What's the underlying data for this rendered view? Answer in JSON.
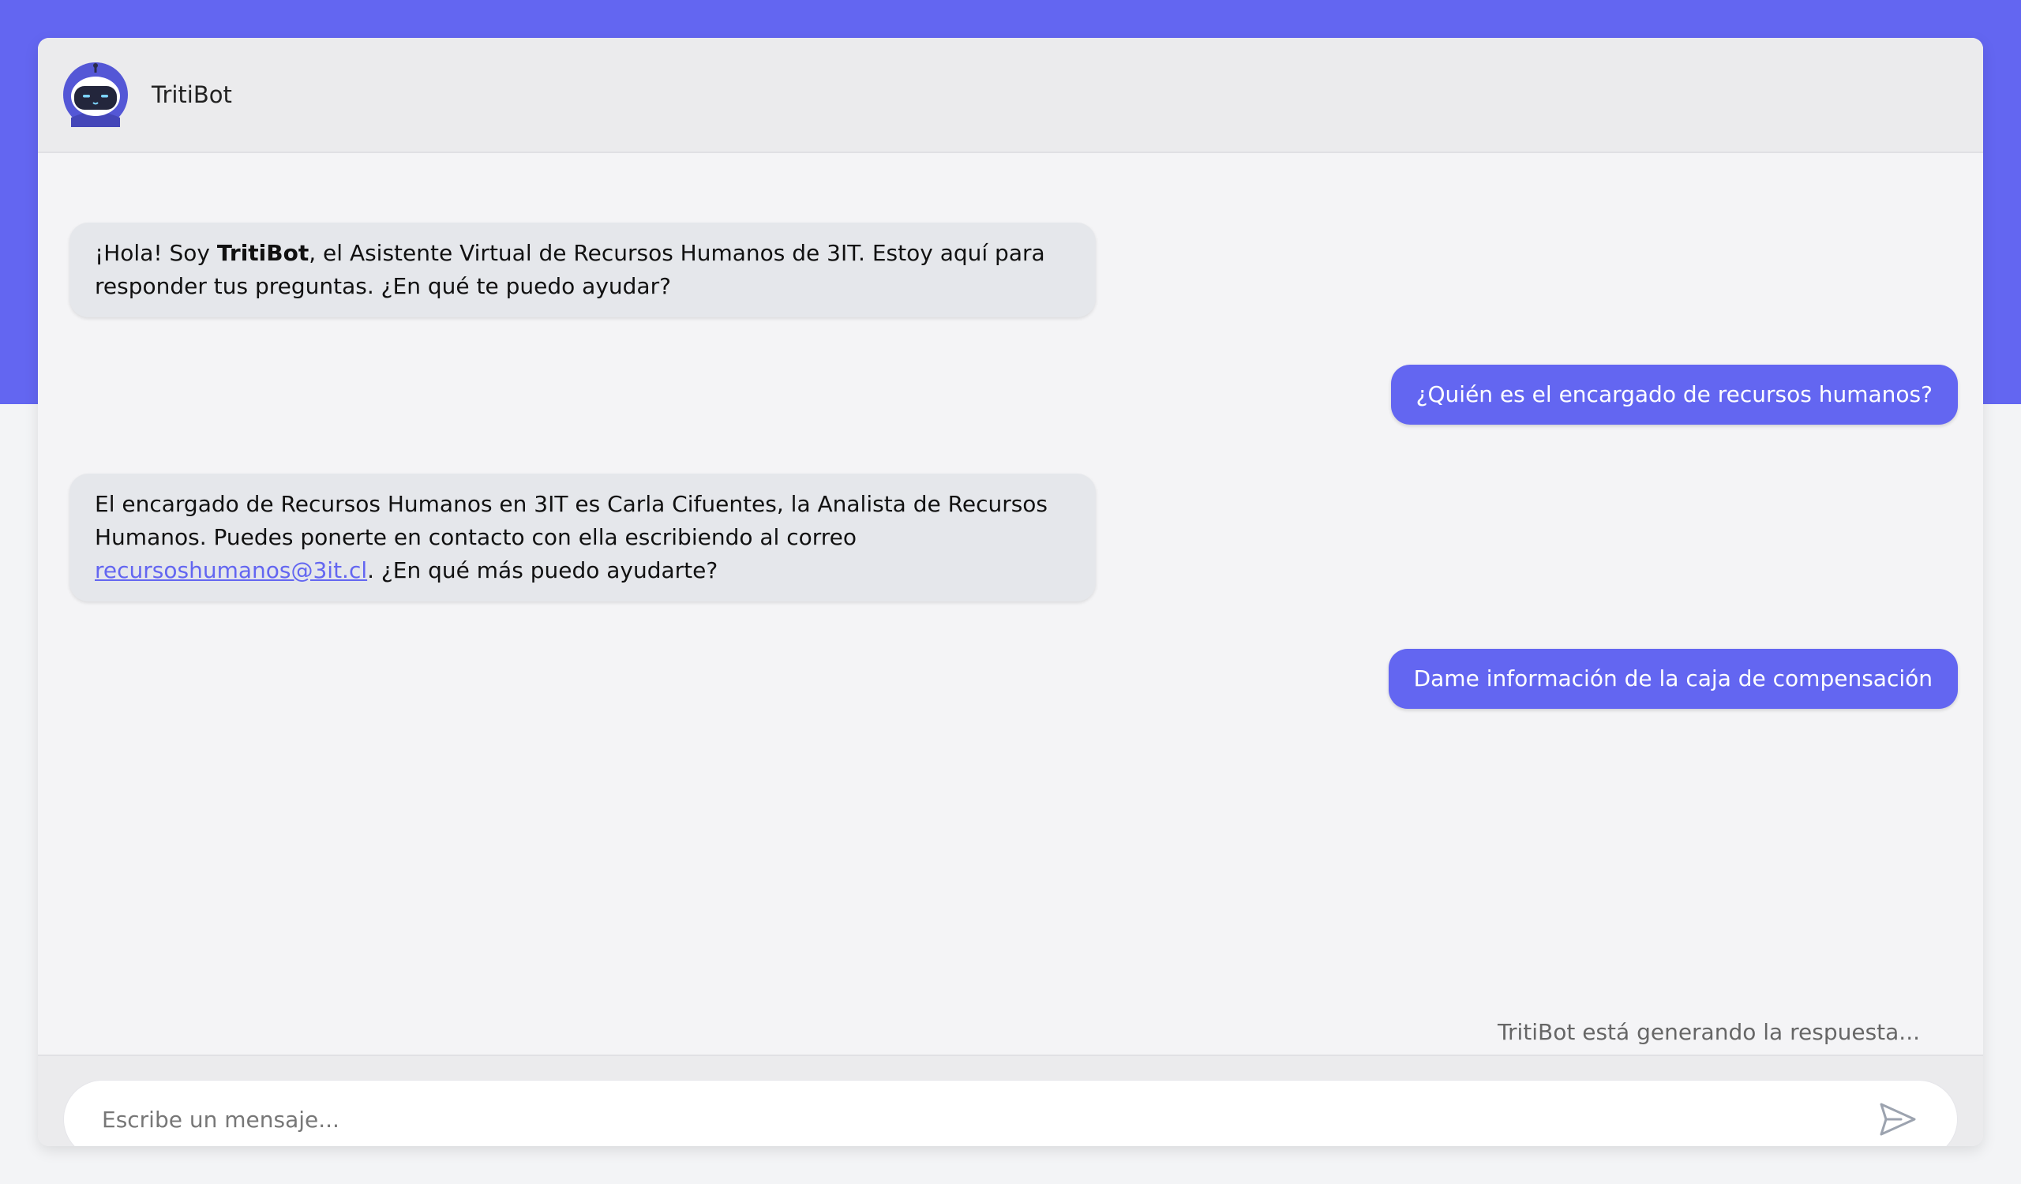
{
  "header": {
    "bot_name": "TritiBot"
  },
  "messages": {
    "bot_1": {
      "before": "¡Hola! Soy ",
      "bold": "TritiBot",
      "after": ", el Asistente Virtual de Recursos Humanos de 3IT. Estoy aquí para responder tus preguntas. ¿En qué te puedo ayudar?"
    },
    "user_1": "¿Quién es el encargado de recursos humanos?",
    "bot_2": {
      "before": "El encargado de Recursos Humanos en 3IT es Carla Cifuentes, la Analista de Recursos Humanos. Puedes ponerte en contacto con ella escribiendo al correo ",
      "link": "recursoshumanos@3it.cl",
      "after": ". ¿En qué más puedo ayudarte?"
    },
    "user_2": "Dame información de la caja de compensación"
  },
  "status": {
    "typing": "TritiBot está generando la respuesta..."
  },
  "composer": {
    "placeholder": "Escribe un mensaje..."
  },
  "icons": {
    "avatar": "robot-avatar-icon",
    "send": "send-icon"
  },
  "colors": {
    "accent": "#6366f1",
    "bot_bubble": "#e5e7eb",
    "header_bg": "#ebebed",
    "chat_bg": "#f4f4f6"
  }
}
